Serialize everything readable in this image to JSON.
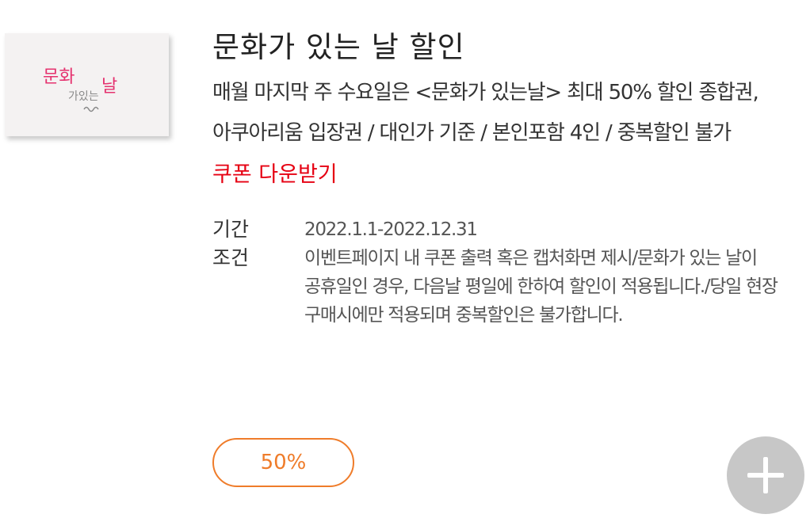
{
  "offer": {
    "title": "문화가 있는 날 할인",
    "description": "매월 마지막 주 수요일은 <문화가 있는날> 최대 50% 할인 종합권, 아쿠아리움 입장권 / 대인가 기준 / 본인포함 4인 / 중복할인 불가",
    "coupon_link": "쿠폰 다운받기"
  },
  "logo": {
    "line1": "문화",
    "line2": "가있는",
    "line3": "날",
    "color_pink": "#e5326f",
    "color_gray": "#8a8a8a"
  },
  "info": {
    "period_label": "기간",
    "period_value": "2022.1.1-2022.12.31",
    "condition_label": "조건",
    "condition_value": "이벤트페이지 내 쿠폰 출력 혹은 캡처화면 제시/문화가 있는 날이 공휴일인 경우, 다음날 평일에 한하여 할인이 적용됩니다./당일 현장 구매시에만 적용되며 중복할인은 불가합니다."
  },
  "discount_badge": "50%",
  "add_button": {
    "icon": "plus-icon"
  },
  "colors": {
    "accent_red": "#e60012",
    "accent_orange": "#ef7c2a",
    "button_gray": "#c7c7c7"
  }
}
